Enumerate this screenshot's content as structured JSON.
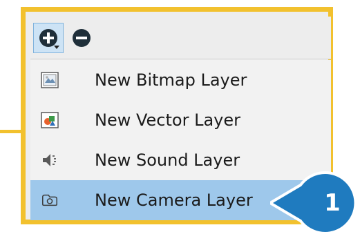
{
  "toolbar": {
    "add_icon": "add-layer-icon",
    "remove_icon": "remove-layer-icon"
  },
  "menu": {
    "items": [
      {
        "label": "New Bitmap Layer",
        "icon": "bitmap-layer-icon"
      },
      {
        "label": "New Vector Layer",
        "icon": "vector-layer-icon"
      },
      {
        "label": "New Sound Layer",
        "icon": "sound-layer-icon"
      },
      {
        "label": "New Camera Layer",
        "icon": "camera-layer-icon",
        "selected": true
      }
    ]
  },
  "callout": {
    "step": "1"
  },
  "colors": {
    "highlight_frame": "#f2c12e",
    "selection": "#9ec8eb",
    "badge": "#1f7bbf"
  }
}
